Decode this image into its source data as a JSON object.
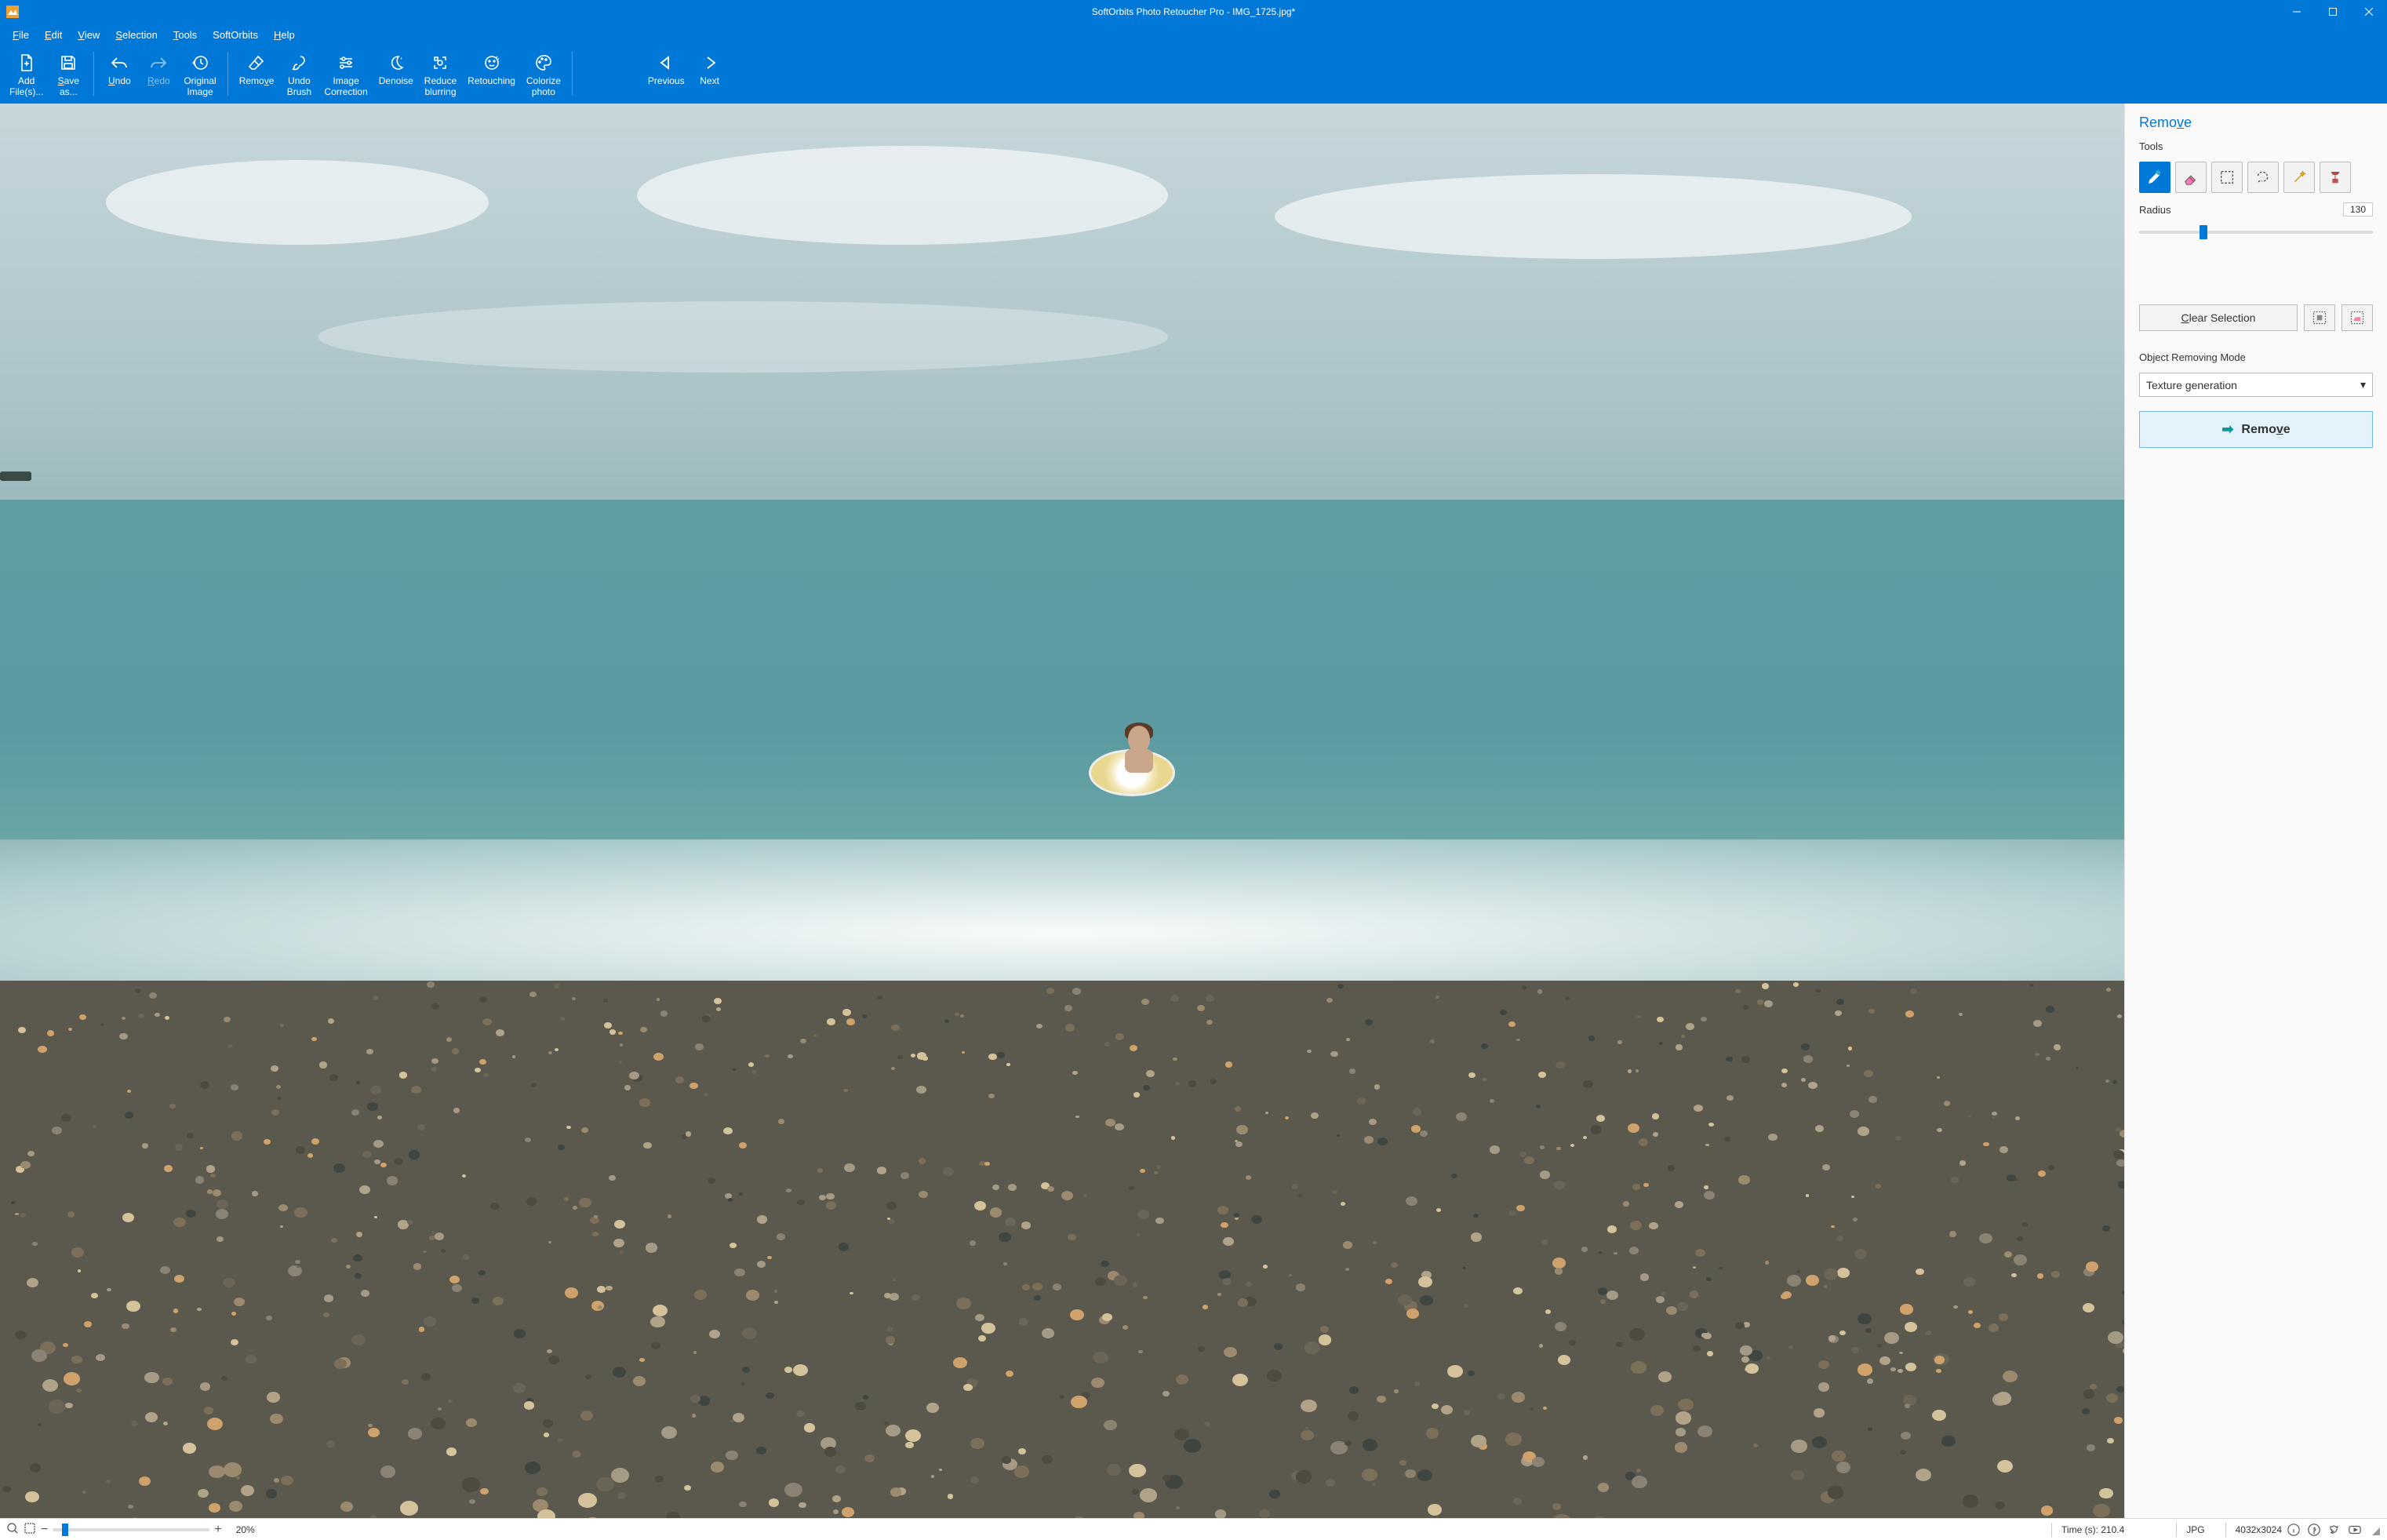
{
  "titlebar": {
    "title": "SoftOrbits Photo Retoucher Pro - IMG_1725.jpg*"
  },
  "menu": {
    "file": "File",
    "edit": "Edit",
    "view": "View",
    "selection": "Selection",
    "tools": "Tools",
    "softorbits": "SoftOrbits",
    "help": "Help"
  },
  "toolbar": {
    "add_files": "Add\nFile(s)...",
    "save_as": "Save\nas...",
    "undo": "Undo",
    "redo": "Redo",
    "original_image": "Original\nImage",
    "remove": "Remove",
    "undo_brush": "Undo\nBrush",
    "image_correction": "Image\nCorrection",
    "denoise": "Denoise",
    "reduce_blurring": "Reduce\nblurring",
    "retouching": "Retouching",
    "colorize_photo": "Colorize\nphoto",
    "previous": "Previous",
    "next": "Next"
  },
  "panel": {
    "title": "Remove",
    "tools_label": "Tools",
    "radius_label": "Radius",
    "radius_value": "130",
    "clear_selection": "Clear Selection",
    "mode_label": "Object Removing Mode",
    "mode_value": "Texture generation",
    "remove_button": "Remove"
  },
  "status": {
    "zoom_pct": "20%",
    "time_label": "Time (s): 210.4",
    "format": "JPG",
    "dimensions": "4032x3024"
  }
}
